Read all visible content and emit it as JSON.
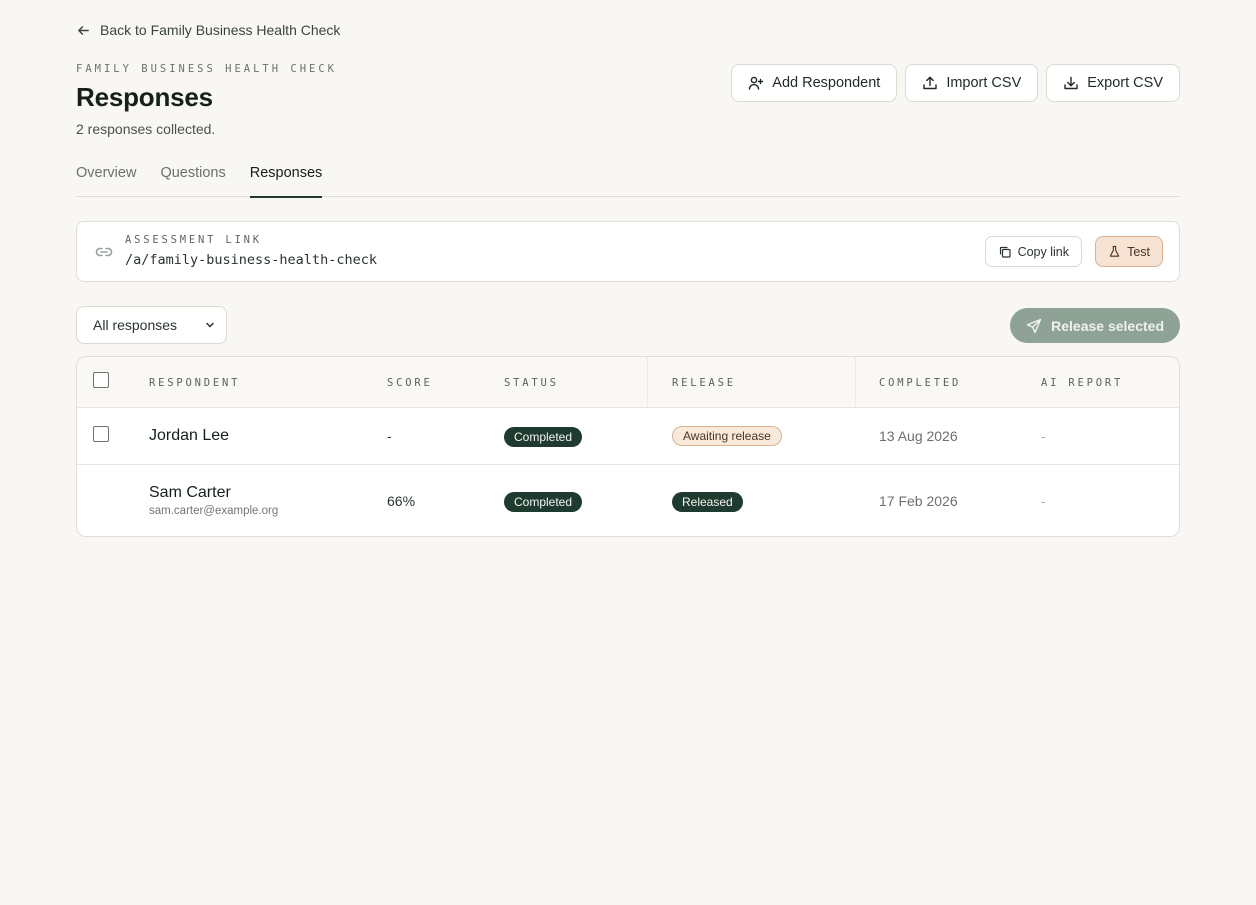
{
  "back_link": {
    "label": "Back to Family Business Health Check"
  },
  "header": {
    "eyebrow": "FAMILY BUSINESS HEALTH CHECK",
    "title": "Responses",
    "subtitle": "2 responses collected."
  },
  "actions": {
    "add_respondent": "Add Respondent",
    "import_csv": "Import CSV",
    "export_csv": "Export CSV"
  },
  "tabs": [
    {
      "label": "Overview",
      "active": false
    },
    {
      "label": "Questions",
      "active": false
    },
    {
      "label": "Responses",
      "active": true
    }
  ],
  "assessment_link": {
    "label": "ASSESSMENT LINK",
    "url": "/a/family-business-health-check",
    "copy_label": "Copy link",
    "test_label": "Test"
  },
  "filter": {
    "selected": "All responses"
  },
  "release_button": {
    "label": "Release selected"
  },
  "table": {
    "columns": [
      "RESPONDENT",
      "SCORE",
      "STATUS",
      "RELEASE",
      "COMPLETED",
      "AI REPORT"
    ],
    "rows": [
      {
        "name": "Jordan Lee",
        "email": "",
        "score": "-",
        "status": "Completed",
        "release": "Awaiting release",
        "completed": "13 Aug 2026",
        "ai_report": "-"
      },
      {
        "name": "Sam Carter",
        "email": "sam.carter@example.org",
        "score": "66%",
        "status": "Completed",
        "release": "Released",
        "completed": "17 Feb 2026",
        "ai_report": "-"
      }
    ]
  },
  "colors": {
    "background": "#f9f7f3",
    "accent_dark": "#1f3a2e",
    "release_button": "#8ea295",
    "awaiting_pill": "#f8e9db"
  }
}
